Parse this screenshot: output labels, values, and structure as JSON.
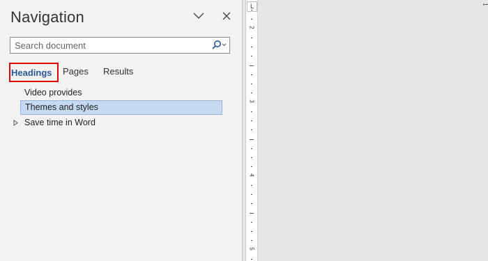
{
  "pane": {
    "title": "Navigation",
    "options_icon": "chevron-down-icon",
    "close_icon": "close-icon"
  },
  "search": {
    "placeholder": "Search document",
    "icon": "search-icon"
  },
  "tabs": [
    {
      "label": "Headings",
      "active": true
    },
    {
      "label": "Pages",
      "active": false
    },
    {
      "label": "Results",
      "active": false
    }
  ],
  "tree": {
    "items": [
      {
        "label": "Video provides",
        "selected": false,
        "expandable": false
      },
      {
        "label": "Themes and styles",
        "selected": true,
        "expandable": false
      },
      {
        "label": "Save time in Word",
        "selected": false,
        "expandable": true
      }
    ]
  },
  "ruler": {
    "tab_selector": "L",
    "numbers": [
      "2",
      "3",
      "4",
      "5"
    ],
    "corner_number": "1"
  },
  "colors": {
    "active_tab_text": "#2b579a",
    "active_tab_outline": "#e00000",
    "selected_item_bg": "#c5d9f1"
  }
}
